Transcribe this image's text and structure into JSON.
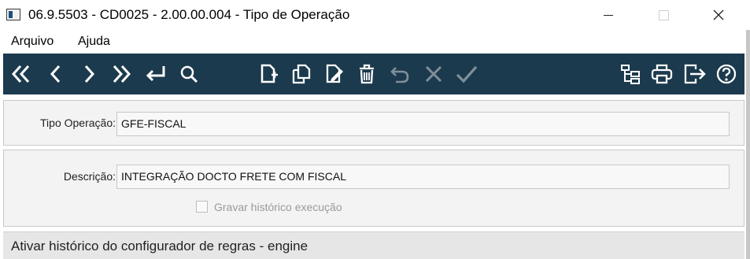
{
  "window": {
    "title": "06.9.5503 - CD0025 - 2.00.00.004 - Tipo de Operação",
    "app_icon": "app-window-icon"
  },
  "menu": {
    "items": [
      {
        "label": "Arquivo"
      },
      {
        "label": "Ajuda"
      }
    ]
  },
  "toolbar": {
    "background": "#1c3a4d",
    "icon_color": "#ffffff",
    "disabled_icon_color": "#7f8f99",
    "icons": [
      "first-record-icon",
      "previous-record-icon",
      "next-record-icon",
      "last-record-icon",
      "goto-enter-icon",
      "search-icon",
      "new-document-icon",
      "copy-document-icon",
      "edit-document-icon",
      "delete-icon",
      "undo-icon",
      "cancel-icon",
      "confirm-icon",
      "hierarchy-icon",
      "print-icon",
      "exit-icon",
      "help-icon"
    ]
  },
  "form": {
    "tipo_operacao": {
      "label": "Tipo Operação:",
      "value": "GFE-FISCAL"
    },
    "descricao": {
      "label": "Descrição:",
      "value": "INTEGRAÇÃO DOCTO FRETE COM FISCAL"
    },
    "gravar_historico": {
      "label": "Gravar histórico execução",
      "checked": false,
      "enabled": false
    }
  },
  "section": {
    "title": "Ativar histórico do configurador de regras - engine"
  }
}
